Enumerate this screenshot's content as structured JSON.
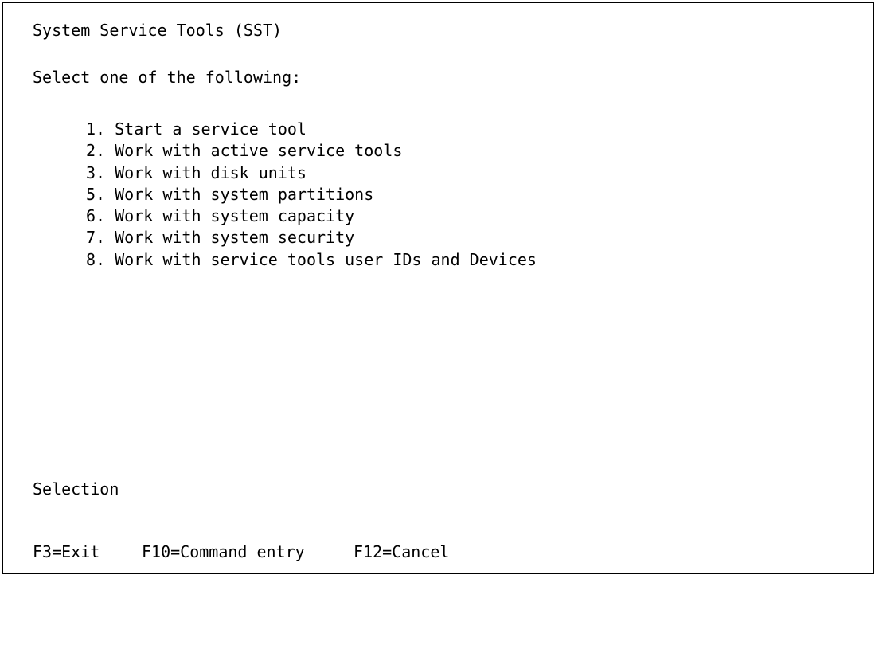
{
  "screen": {
    "title": "System Service Tools (SST)",
    "instruction": "Select one of the following:",
    "menu_items": [
      {
        "number": "1.",
        "label": "Start a service tool"
      },
      {
        "number": "2.",
        "label": "Work with active service tools"
      },
      {
        "number": "3.",
        "label": "Work with disk units"
      },
      {
        "number": "5.",
        "label": "Work with system partitions"
      },
      {
        "number": "6.",
        "label": "Work with system capacity"
      },
      {
        "number": "7.",
        "label": "Work with system security"
      },
      {
        "number": "8.",
        "label": "Work with service tools user IDs and Devices"
      }
    ],
    "selection_label": "Selection",
    "selection_value": ""
  },
  "function_keys": {
    "exit": "F3=Exit",
    "command_entry": "F10=Command entry",
    "cancel": "F12=Cancel"
  }
}
